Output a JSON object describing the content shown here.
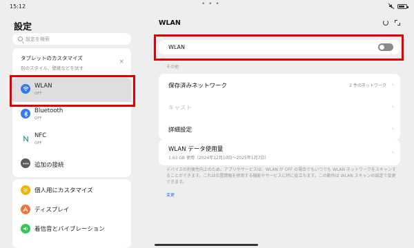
{
  "status_bar": {
    "time": "15:12",
    "dots": "• • •"
  },
  "left_pane": {
    "title": "設定",
    "search_placeholder": "設定を検索",
    "customize_card": {
      "title": "タブレットのカスタマイズ",
      "subtitle": "別のスタイル、壁紙などを試す",
      "close": "×"
    },
    "network_items": [
      {
        "label": "WLAN",
        "sub": "OFF",
        "icon": "wifi-icon",
        "color": "#3478f6"
      },
      {
        "label": "Bluetooth",
        "sub": "OFF",
        "icon": "bluetooth-icon",
        "color": "#3478f6"
      },
      {
        "label": "NFC",
        "sub": "OFF",
        "icon": "nfc-icon",
        "color": "#2a9d8f"
      },
      {
        "label": "追加の接続",
        "icon": "more-connections-icon",
        "color": "#5a5a5f"
      }
    ],
    "display_items": [
      {
        "label": "個人用にカスタマイズ",
        "icon": "customize-icon",
        "color": "#f5b400"
      },
      {
        "label": "ディスプレイ",
        "icon": "display-icon",
        "color": "#f0743a"
      },
      {
        "label": "着信音とバイブレーション",
        "icon": "sound-icon",
        "color": "#34c759"
      }
    ]
  },
  "right_pane": {
    "title": "WLAN",
    "wlan_toggle": {
      "label": "WLAN",
      "state": "off"
    },
    "section_label": "その他",
    "rows": [
      {
        "label": "保存済みネットワーク",
        "value": "2 件のネットワーク",
        "disabled": false
      },
      {
        "label": "キャスト",
        "value": "",
        "disabled": true
      },
      {
        "label": "詳細設定",
        "value": "",
        "disabled": false
      }
    ],
    "usage": {
      "label": "WLAN データ使用量",
      "sub": "1.63 GB 使用（2024年12月10日〜2025年1月7日）"
    },
    "note": "デバイスの利便性向上のため、アプリやサービスは、WLAN が OFF の場合でもいつでも WLAN ネットワークをスキャンすることができます。これは位置情報を使用する機能やサービスに特に役立ちます。この動作は WLAN スキャンの設定で変更できます。",
    "link": "変更"
  },
  "highlight_color": "#e00000"
}
